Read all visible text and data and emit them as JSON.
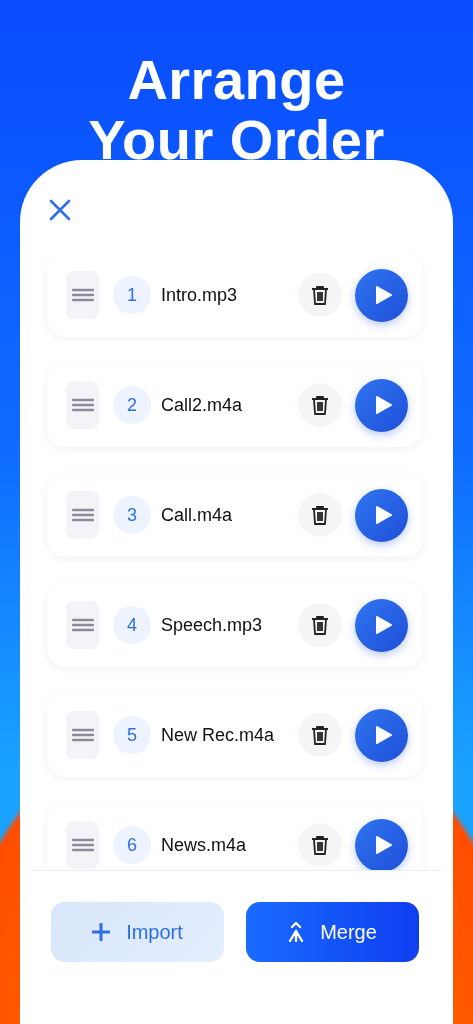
{
  "headline": [
    "Arrange",
    "Your Order"
  ],
  "files": [
    {
      "number": "1",
      "name": "Intro.mp3"
    },
    {
      "number": "2",
      "name": "Call2.m4a"
    },
    {
      "number": "3",
      "name": "Call.m4a"
    },
    {
      "number": "4",
      "name": "Speech.mp3"
    },
    {
      "number": "5",
      "name": "New Rec.m4a"
    },
    {
      "number": "6",
      "name": "News.m4a"
    }
  ],
  "buttons": [
    {
      "kind": "import",
      "label": "Import"
    },
    {
      "kind": "merge",
      "label": "Merge"
    }
  ]
}
